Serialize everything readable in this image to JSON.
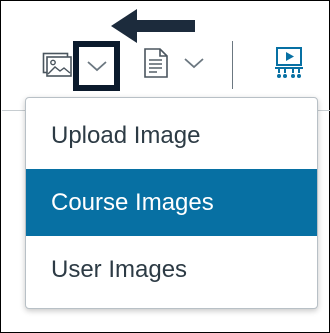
{
  "toolbar": {
    "image_icon": "image-icon",
    "image_chevron_icon": "chevron-down-icon",
    "document_icon": "document-icon",
    "document_chevron_icon": "chevron-down-icon",
    "media_icon": "media-presentation-icon"
  },
  "menu": {
    "items": [
      {
        "label": "Upload Image",
        "active": false
      },
      {
        "label": "Course Images",
        "active": true
      },
      {
        "label": "User Images",
        "active": false
      }
    ]
  },
  "colors": {
    "highlight_box": "#0b1a2c",
    "arrow": "#1c2b3c",
    "active_item_bg": "#0770a3",
    "active_item_text": "#ffffff",
    "item_text": "#2d3b45",
    "icon_gray": "#6b7780",
    "media_icon_blue": "#0770a3"
  }
}
